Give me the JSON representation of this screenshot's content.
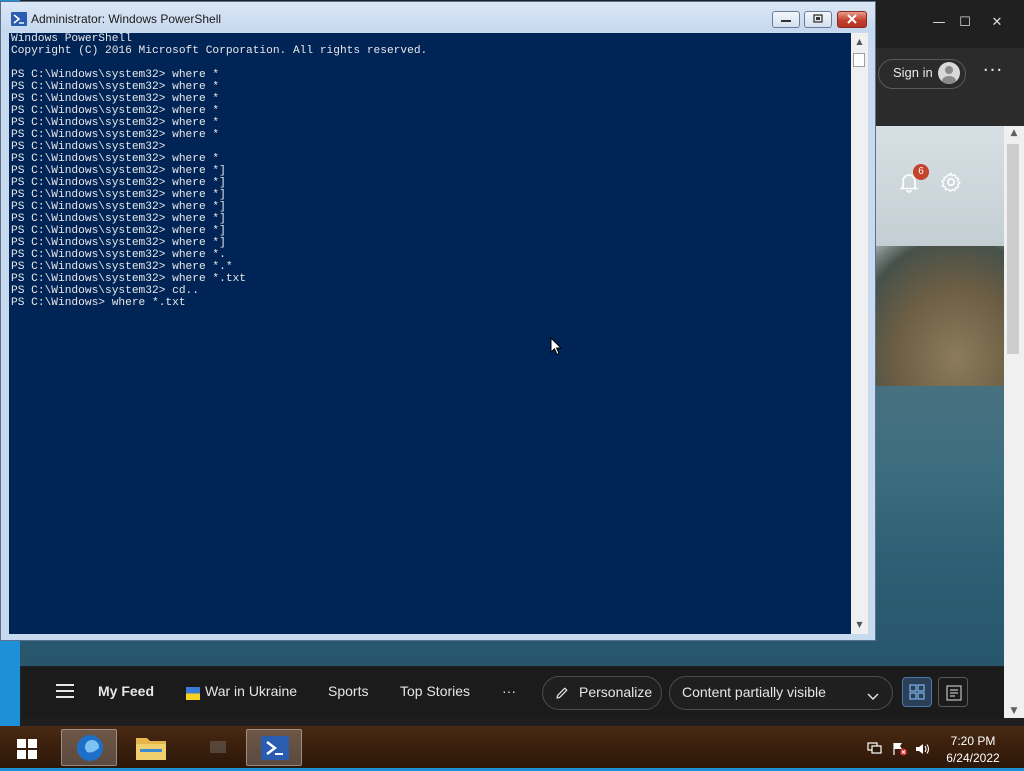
{
  "edge": {
    "signin_label": "Sign in",
    "notification_count": "6",
    "nav": {
      "my_feed": "My Feed",
      "war_in_ukraine": "War in Ukraine",
      "sports": "Sports",
      "top_stories": "Top Stories",
      "more": "···",
      "personalize": "Personalize",
      "content_visibility": "Content partially visible"
    },
    "icons": [
      "minimize-icon",
      "maximize-icon",
      "close-icon",
      "avatar-icon",
      "more-icon",
      "bell-icon",
      "gear-icon",
      "hamburger-icon",
      "ukraine-flag-icon",
      "pencil-icon",
      "chevron-down-icon",
      "grid-view-icon",
      "list-view-icon"
    ]
  },
  "powershell": {
    "title": "Administrator: Windows PowerShell",
    "lines": [
      "Windows PowerShell",
      "Copyright (C) 2016 Microsoft Corporation. All rights reserved.",
      "",
      "PS C:\\Windows\\system32> where *",
      "PS C:\\Windows\\system32> where *",
      "PS C:\\Windows\\system32> where *",
      "PS C:\\Windows\\system32> where *",
      "PS C:\\Windows\\system32> where *",
      "PS C:\\Windows\\system32> where *",
      "PS C:\\Windows\\system32>",
      "PS C:\\Windows\\system32> where *",
      "PS C:\\Windows\\system32> where *]",
      "PS C:\\Windows\\system32> where *]",
      "PS C:\\Windows\\system32> where *]",
      "PS C:\\Windows\\system32> where *]",
      "PS C:\\Windows\\system32> where *]",
      "PS C:\\Windows\\system32> where *]",
      "PS C:\\Windows\\system32> where *]",
      "PS C:\\Windows\\system32> where *.",
      "PS C:\\Windows\\system32> where *.*",
      "PS C:\\Windows\\system32> where *.txt",
      "PS C:\\Windows\\system32> cd..",
      "PS C:\\Windows> where *.txt"
    ]
  },
  "taskbar": {
    "time": "7:20 PM",
    "date": "6/24/2022",
    "apps": [
      "start-button",
      "edge-taskbar-button",
      "file-explorer-taskbar-button",
      "powershell-taskbar-button"
    ]
  },
  "colors": {
    "ps_background": "#012456",
    "ps_text": "#e8e8e8",
    "desktop": "#1e90d8",
    "badge": "#c4432b"
  }
}
